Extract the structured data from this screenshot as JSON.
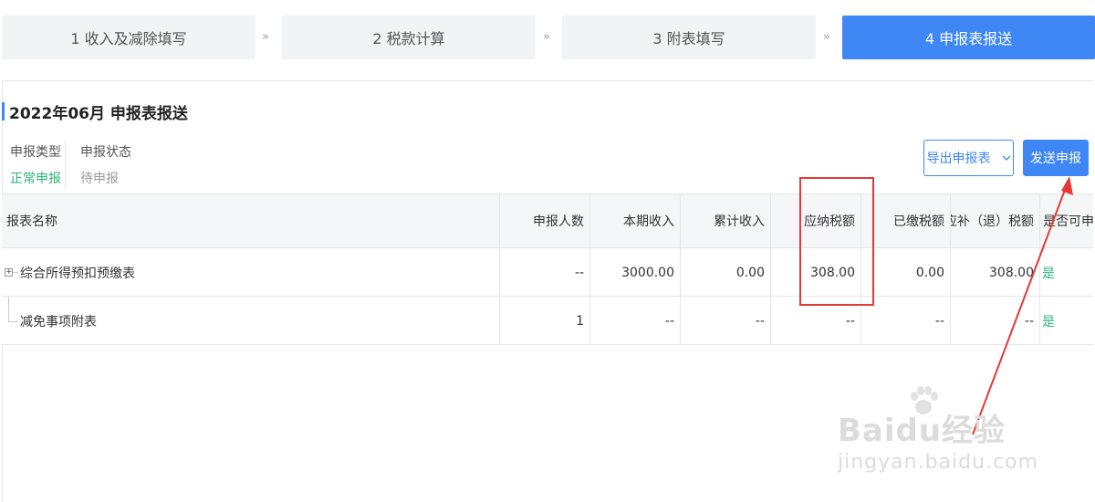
{
  "steps": [
    {
      "label": "1 收入及减除填写",
      "active": false
    },
    {
      "label": "2 税款计算",
      "active": false
    },
    {
      "label": "3 附表填写",
      "active": false
    },
    {
      "label": "4 申报表报送",
      "active": true
    }
  ],
  "step_separator": "»",
  "page_title": "2022年06月 申报表报送",
  "meta": {
    "type_label": "申报类型",
    "type_value": "正常申报",
    "status_label": "申报状态",
    "status_value": "待申报"
  },
  "buttons": {
    "export_label": "导出申报表",
    "send_label": "发送申报"
  },
  "table": {
    "headers": [
      "报表名称",
      "申报人数",
      "本期收入",
      "累计收入",
      "应纳税额",
      "已缴税额",
      "应补（退）税额",
      "是否可申..."
    ],
    "rows": [
      {
        "name": "综合所得预扣预缴表",
        "people": "--",
        "income": "3000.00",
        "cumulative": "0.00",
        "tax_due": "308.00",
        "tax_paid": "0.00",
        "tax_refund": "308.00",
        "can_file": "是"
      },
      {
        "name": "减免事项附表",
        "people": "1",
        "income": "--",
        "cumulative": "--",
        "tax_due": "--",
        "tax_paid": "--",
        "tax_refund": "--",
        "can_file": "是"
      }
    ]
  },
  "watermark": {
    "main": "Baidu经验",
    "sub": "jingyan.baidu.com"
  },
  "colors": {
    "accent": "#3f87f5",
    "success": "#2bb673",
    "annotation": "#e53935"
  }
}
